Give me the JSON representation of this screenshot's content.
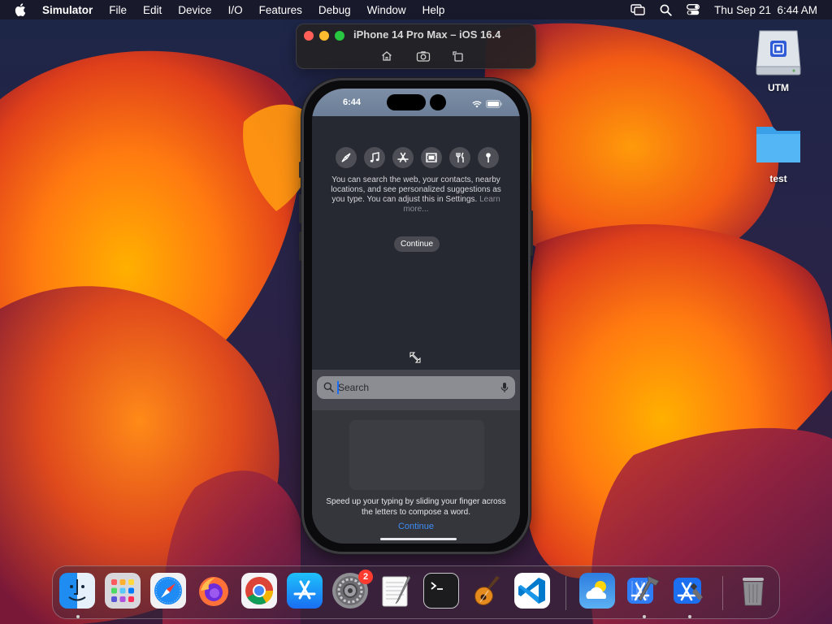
{
  "menubar": {
    "app_name": "Simulator",
    "items": [
      "File",
      "Edit",
      "Device",
      "I/O",
      "Features",
      "Debug",
      "Window",
      "Help"
    ],
    "datetime": "Thu Sep 21  6:44 AM",
    "right_icons": [
      "screen-mirroring-icon",
      "spotlight-search-icon",
      "control-center-icon"
    ]
  },
  "simulator_window": {
    "title": "iPhone 14 Pro Max – iOS 16.4",
    "tools": [
      "home-icon",
      "screenshot-icon",
      "rotate-icon"
    ]
  },
  "phone": {
    "status_time": "6:44",
    "suggestion_icons": [
      "compass-icon",
      "music-note-icon",
      "app-store-icon",
      "film-icon",
      "fork-knife-icon",
      "pin-icon"
    ],
    "info_text": "You can search the web, your contacts, nearby locations, and see personalized suggestions as you type. You can adjust this in Settings.",
    "learn_more": "Learn more...",
    "continue_button": "Continue",
    "search_placeholder": "Search",
    "swipe_text": "Speed up your typing by sliding your finger across the letters to compose a word.",
    "continue_link": "Continue"
  },
  "desktop": {
    "icons": [
      {
        "label": "UTM",
        "icon": "drive-icon"
      },
      {
        "label": "test",
        "icon": "folder-icon"
      }
    ]
  },
  "dock": {
    "apps": [
      {
        "name": "Finder",
        "icon": "finder-icon",
        "running": true
      },
      {
        "name": "Launchpad",
        "icon": "launchpad-icon",
        "running": false
      },
      {
        "name": "Safari",
        "icon": "safari-icon",
        "running": false
      },
      {
        "name": "Firefox",
        "icon": "firefox-icon",
        "running": false
      },
      {
        "name": "Chrome",
        "icon": "chrome-icon",
        "running": false
      },
      {
        "name": "App Store",
        "icon": "app-store-icon",
        "running": false
      },
      {
        "name": "System Settings",
        "icon": "system-settings-icon",
        "running": false,
        "badge": "2"
      },
      {
        "name": "TextEdit",
        "icon": "textedit-icon",
        "running": false
      },
      {
        "name": "Terminal",
        "icon": "terminal-icon",
        "running": false
      },
      {
        "name": "GarageBand",
        "icon": "garageband-icon",
        "running": false
      },
      {
        "name": "Visual Studio Code",
        "icon": "vscode-icon",
        "running": false
      },
      {
        "name": "Weather",
        "icon": "weather-icon",
        "running": false
      },
      {
        "name": "Xcode",
        "icon": "xcode-icon",
        "running": true
      },
      {
        "name": "Simulator",
        "icon": "simulator-icon",
        "running": true
      },
      {
        "name": "Trash",
        "icon": "trash-icon",
        "running": false
      }
    ]
  },
  "colors": {
    "accent_blue": "#3d8cf6",
    "close": "#ff5f57",
    "minimize": "#febc2e",
    "zoom": "#28c840",
    "badge": "#ff3b30"
  }
}
